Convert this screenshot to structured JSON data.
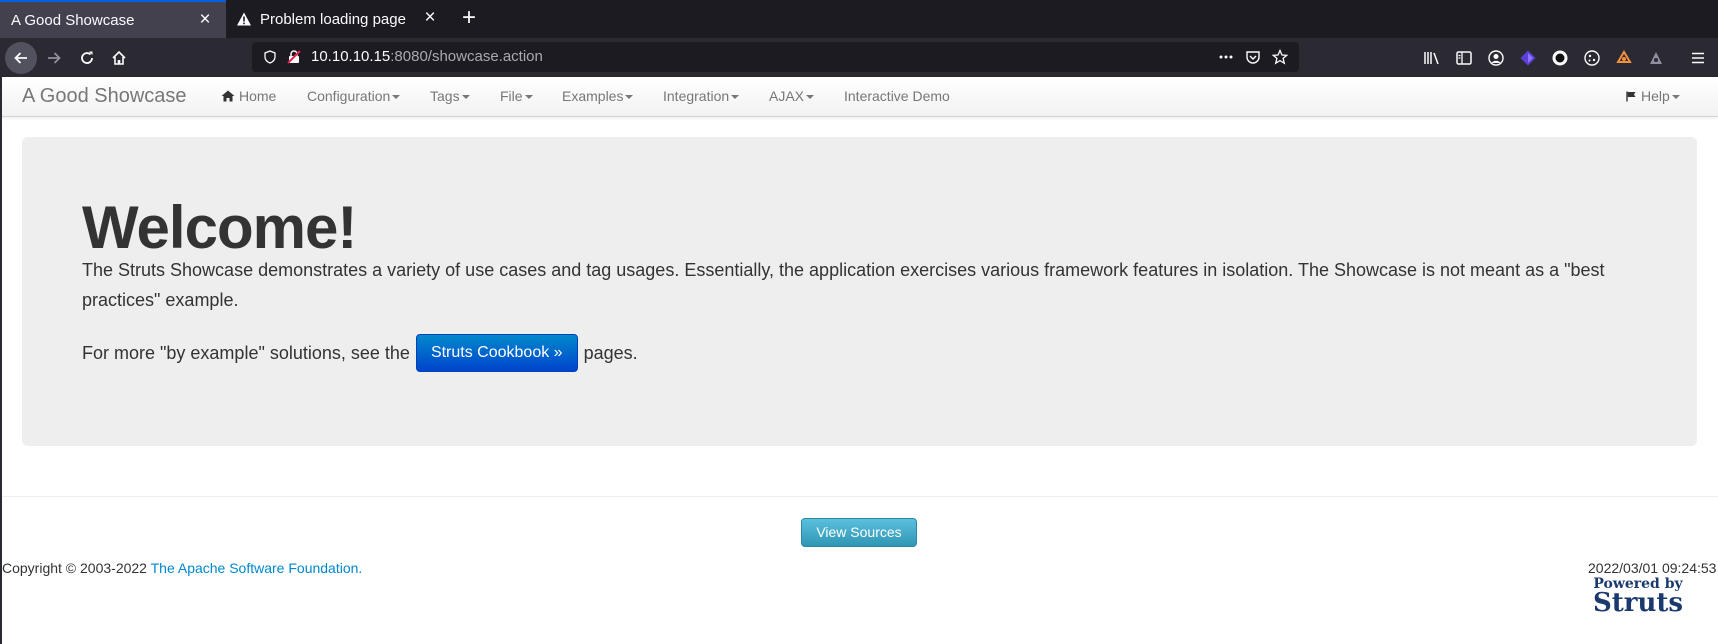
{
  "browser": {
    "tabs": [
      {
        "title": "A Good Showcase",
        "active": true
      },
      {
        "title": "Problem loading page",
        "active": false
      }
    ],
    "url": {
      "host": "10.10.10.15",
      "rest": ":8080/showcase.action"
    },
    "accent_color": "#0060df"
  },
  "site": {
    "brand": "A Good Showcase",
    "menu": {
      "home": "Home",
      "configuration": "Configuration",
      "tags": "Tags",
      "file": "File",
      "examples": "Examples",
      "integration": "Integration",
      "ajax": "AJAX",
      "interactive_demo": "Interactive Demo",
      "help": "Help"
    }
  },
  "hero": {
    "title": "Welcome!",
    "text": "The Struts Showcase demonstrates a variety of use cases and tag usages. Essentially, the application exercises various framework features in isolation. The Showcase is not meant as a \"best practices\" example.",
    "more_prefix": "For more \"by example\" solutions, see the",
    "cookbook_label": "Struts Cookbook »",
    "more_suffix": "pages."
  },
  "footer": {
    "view_sources_label": "View Sources",
    "copyright_prefix": "Copyright © 2003-2022",
    "copyright_link": "The Apache Software Foundation.",
    "timestamp": "2022/03/01 09:24:53",
    "powered_small": "Powered by",
    "powered_big": "Struts"
  },
  "colors": {
    "primary_button": "#0044cc",
    "info_button": "#2f96b4",
    "link": "#0088cc"
  }
}
